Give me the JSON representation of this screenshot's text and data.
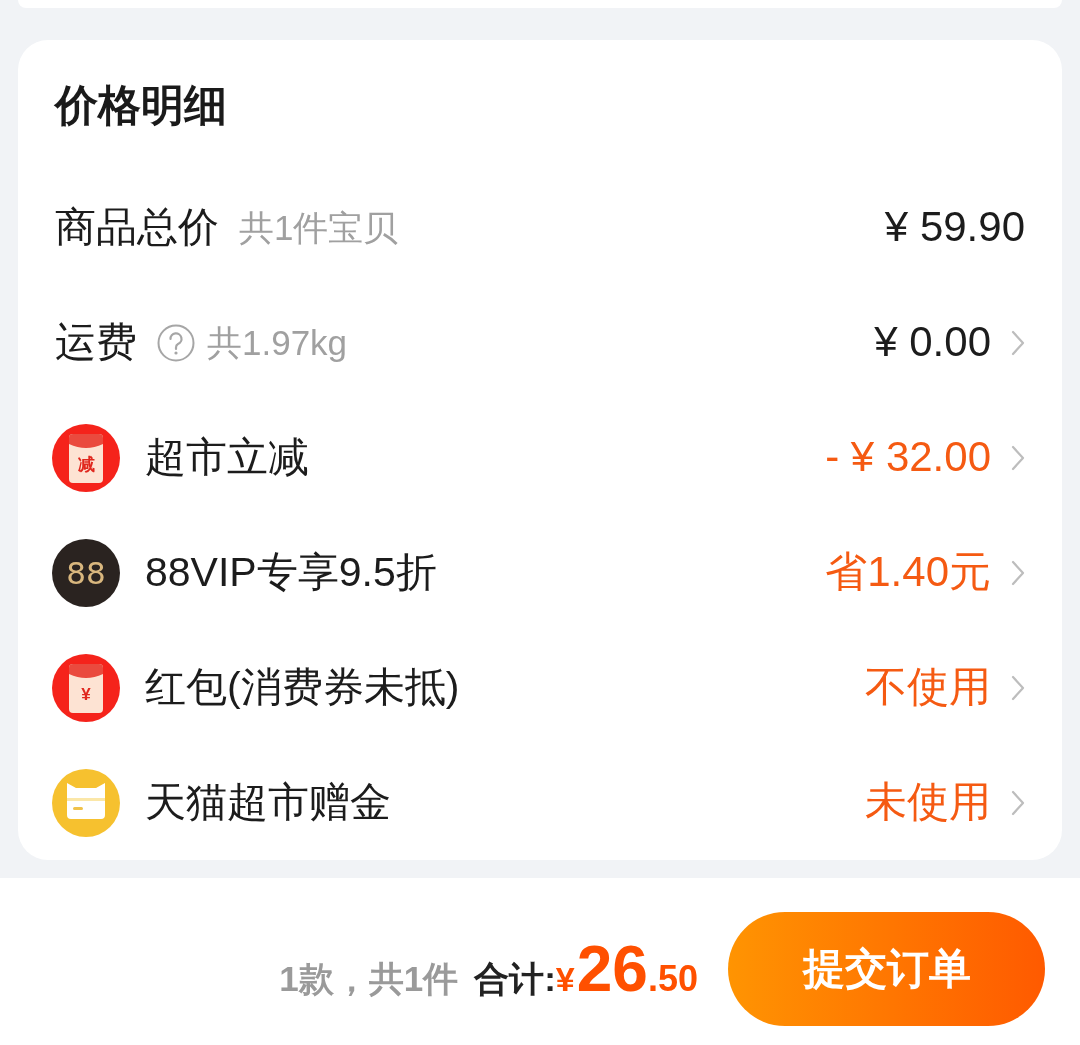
{
  "price_detail": {
    "title": "价格明细",
    "rows": [
      {
        "kind": "plain",
        "label": "商品总价",
        "help": false,
        "note": "共1件宝贝",
        "value": "¥ 59.90",
        "highlight": false,
        "chevron": false
      },
      {
        "kind": "plain",
        "label": "运费",
        "help": true,
        "note": "共1.97kg",
        "value": "¥ 0.00",
        "highlight": false,
        "chevron": true
      },
      {
        "kind": "envelope",
        "icon_text": "减",
        "label": "超市立减",
        "value": "- ¥ 32.00",
        "highlight": true,
        "chevron": true
      },
      {
        "kind": "vip",
        "icon_text": "88",
        "label": "88VIP专享9.5折",
        "value": "省1.40元",
        "highlight": true,
        "chevron": true
      },
      {
        "kind": "envelope",
        "icon_text": "¥",
        "label": "红包(消费券未抵)",
        "value": "不使用",
        "highlight": true,
        "chevron": true
      },
      {
        "kind": "card",
        "label": "天猫超市赠金",
        "value": "未使用",
        "highlight": true,
        "chevron": true
      }
    ]
  },
  "footer": {
    "count": "1款，共1件",
    "total_label": "合计:",
    "currency": "¥",
    "total_integer": "26",
    "total_decimal": ".50",
    "submit": "提交订单"
  }
}
